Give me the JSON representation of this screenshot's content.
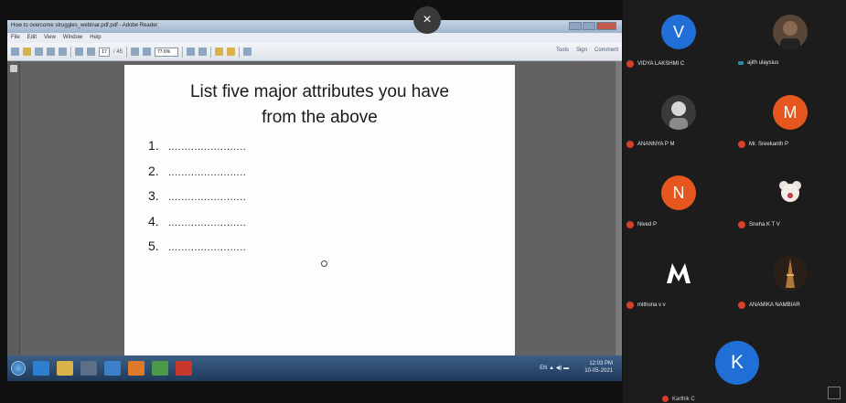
{
  "window": {
    "title": "How to overcome struggles_webinar.pdf.pdf - Adobe Reader",
    "menu": [
      "File",
      "Edit",
      "View",
      "Window",
      "Help"
    ],
    "page_current": "17",
    "page_total": "/ 45",
    "zoom": "77.6%",
    "toolbar_right": [
      "Tools",
      "Sign",
      "Comment"
    ]
  },
  "overlay": {
    "close_label": "×"
  },
  "document": {
    "title_line1": "List five major attributes you have",
    "title_line2": "from the above",
    "items": [
      {
        "num": "1.",
        "dots": "........................"
      },
      {
        "num": "2.",
        "dots": "........................"
      },
      {
        "num": "3.",
        "dots": "........................"
      },
      {
        "num": "4.",
        "dots": "........................"
      },
      {
        "num": "5.",
        "dots": "........................"
      }
    ]
  },
  "taskbar": {
    "tray_text": "EN  ▲  ◀)  ▬",
    "time": "12:03 PM",
    "date": "10-05-2021"
  },
  "participants": [
    {
      "initial": "V",
      "name": "VIDYA LAKSHMI C",
      "color": "#1f6fd6",
      "muted": true
    },
    {
      "initial": "",
      "name": "ajith ulaysius",
      "color": "#6b4e3a",
      "muted": false
    },
    {
      "initial": "",
      "name": "ANANNYA P M",
      "color": "#777777",
      "muted": true
    },
    {
      "initial": "M",
      "name": "Mr. Sreekanth P",
      "color": "#e5571f",
      "muted": true
    },
    {
      "initial": "N",
      "name": "Nived P",
      "color": "#e5571f",
      "muted": true
    },
    {
      "initial": "",
      "name": "Sneha K T V",
      "color": "#d8d1c8",
      "muted": true
    },
    {
      "initial": "M",
      "name": "mithuna v v",
      "color": "#1c1c1c",
      "muted": true
    },
    {
      "initial": "",
      "name": "ANAMIKA NAMBIAR",
      "color": "#4a3a2a",
      "muted": true
    }
  ],
  "speaker": {
    "initial": "K",
    "name": "Karthik C",
    "color": "#1f6fd6"
  }
}
